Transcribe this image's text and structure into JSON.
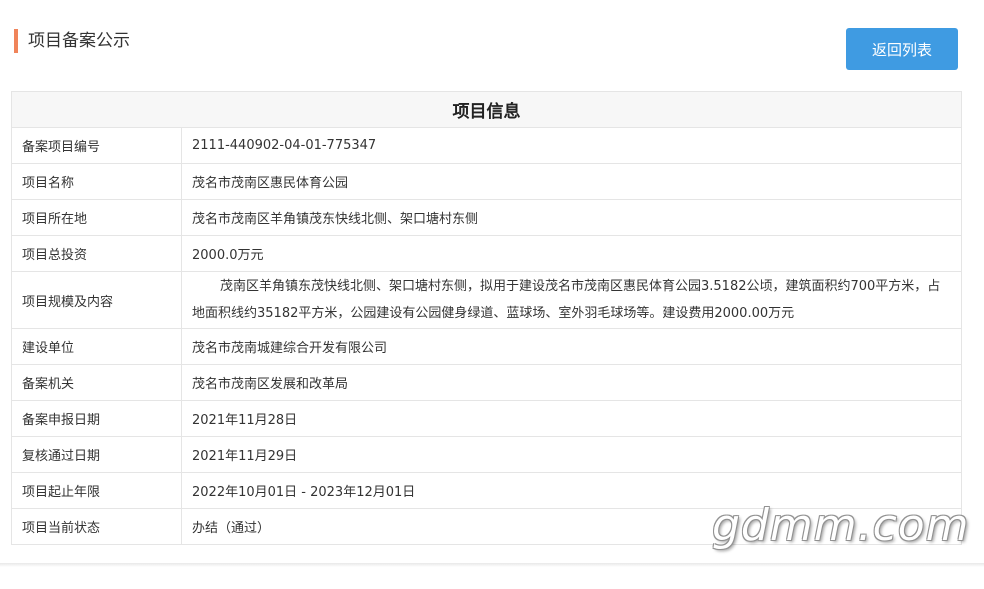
{
  "header": {
    "title": "项目备案公示",
    "back_button_label": "返回列表"
  },
  "table": {
    "heading": "项目信息",
    "rows": [
      {
        "label": "备案项目编号",
        "value": "2111-440902-04-01-775347"
      },
      {
        "label": "项目名称",
        "value": "茂名市茂南区惠民体育公园"
      },
      {
        "label": "项目所在地",
        "value": "茂名市茂南区羊角镇茂东快线北侧、架口塘村东侧"
      },
      {
        "label": "项目总投资",
        "value": "2000.0万元"
      },
      {
        "label": "项目规模及内容",
        "value": "茂南区羊角镇东茂快线北侧、架口塘村东侧，拟用于建设茂名市茂南区惠民体育公园3.5182公顷，建筑面积约700平方米，占地面积线约35182平方米，公园建设有公园健身绿道、蓝球场、室外羽毛球场等。建设费用2000.00万元"
      },
      {
        "label": "建设单位",
        "value": "茂名市茂南城建综合开发有限公司"
      },
      {
        "label": "备案机关",
        "value": "茂名市茂南区发展和改革局"
      },
      {
        "label": "备案申报日期",
        "value": "2021年11月28日"
      },
      {
        "label": "复核通过日期",
        "value": "2021年11月29日"
      },
      {
        "label": "项目起止年限",
        "value": "2022年10月01日 - 2023年12月01日"
      },
      {
        "label": "项目当前状态",
        "value": "办结（通过）"
      }
    ]
  },
  "watermark": "gdmm.com",
  "colors": {
    "accent_bar": "#f0845a",
    "button": "#3f9be2",
    "border": "#e5e5e5",
    "heading_bg": "#f7f7f7"
  }
}
